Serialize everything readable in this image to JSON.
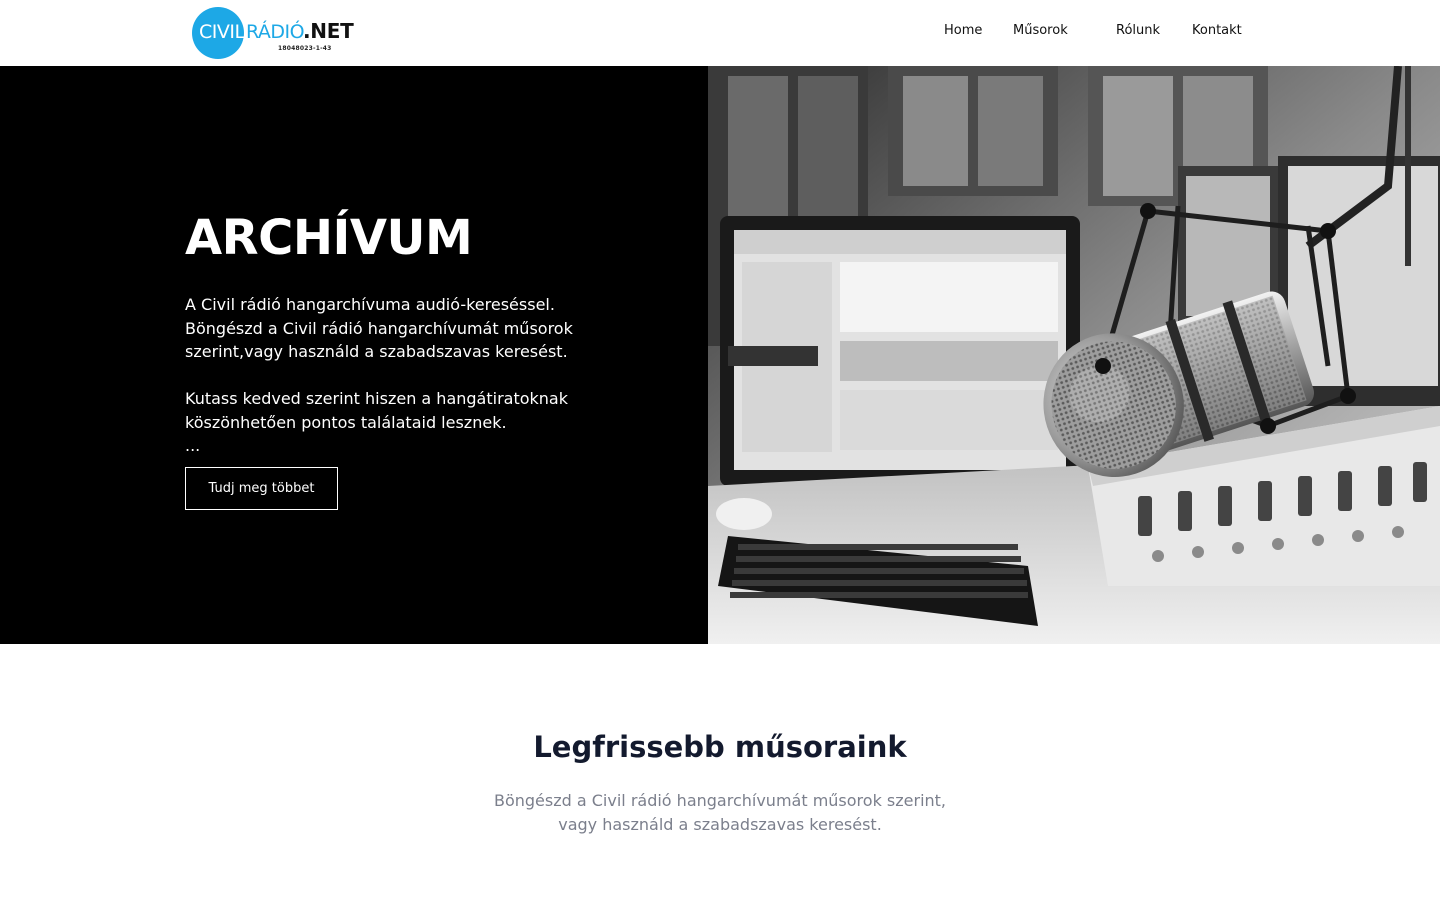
{
  "brand": {
    "logo_civil": "CIVIL",
    "logo_radio": "RÁDIÓ",
    "logo_net": ".NET",
    "logo_reg": "18048023-1-43",
    "accent": "#1da8e6"
  },
  "nav": {
    "items": [
      {
        "label": "Home"
      },
      {
        "label": "Műsorok"
      },
      {
        "label": "Rólunk"
      },
      {
        "label": "Kontakt"
      }
    ]
  },
  "hero": {
    "title": "ARCHÍVUM",
    "lines": [
      "A Civil rádió hangarchívuma audió-kereséssel.",
      "Böngészd a Civil rádió hangarchívumát műsorok",
      "szerint,vagy használd a szabadszavas keresést.",
      "Kutass kedved szerint hiszen a hangátiratoknak",
      "köszönhetően pontos találataid lesznek.",
      "..."
    ],
    "button_label": "Tudj meg többet",
    "image_icon": "radio-studio-microphone-photo"
  },
  "latest": {
    "title": "Legfrissebb műsoraink",
    "sub_line1": "Böngészd a Civil rádió hangarchívumát műsorok szerint,",
    "sub_line2": "vagy használd a szabadszavas keresést."
  }
}
